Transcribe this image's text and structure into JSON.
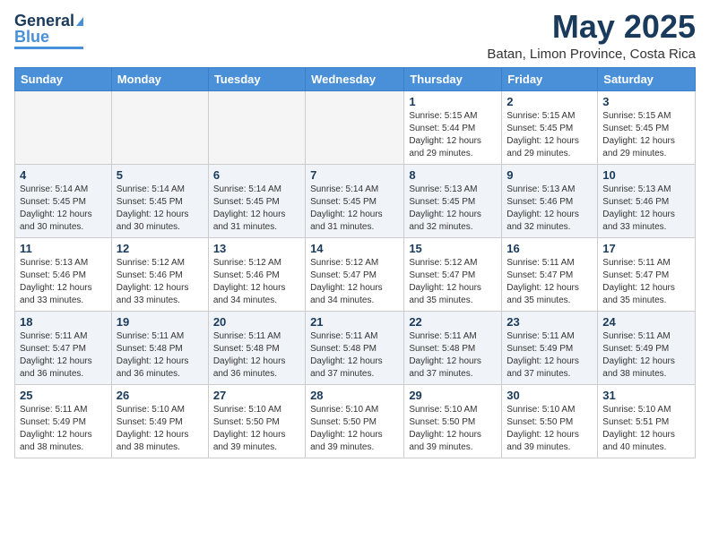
{
  "header": {
    "logo_line1": "General",
    "logo_line2": "Blue",
    "month": "May 2025",
    "location": "Batan, Limon Province, Costa Rica"
  },
  "days_of_week": [
    "Sunday",
    "Monday",
    "Tuesday",
    "Wednesday",
    "Thursday",
    "Friday",
    "Saturday"
  ],
  "weeks": [
    [
      {
        "day": "",
        "info": ""
      },
      {
        "day": "",
        "info": ""
      },
      {
        "day": "",
        "info": ""
      },
      {
        "day": "",
        "info": ""
      },
      {
        "day": "1",
        "info": "Sunrise: 5:15 AM\nSunset: 5:44 PM\nDaylight: 12 hours\nand 29 minutes."
      },
      {
        "day": "2",
        "info": "Sunrise: 5:15 AM\nSunset: 5:45 PM\nDaylight: 12 hours\nand 29 minutes."
      },
      {
        "day": "3",
        "info": "Sunrise: 5:15 AM\nSunset: 5:45 PM\nDaylight: 12 hours\nand 29 minutes."
      }
    ],
    [
      {
        "day": "4",
        "info": "Sunrise: 5:14 AM\nSunset: 5:45 PM\nDaylight: 12 hours\nand 30 minutes."
      },
      {
        "day": "5",
        "info": "Sunrise: 5:14 AM\nSunset: 5:45 PM\nDaylight: 12 hours\nand 30 minutes."
      },
      {
        "day": "6",
        "info": "Sunrise: 5:14 AM\nSunset: 5:45 PM\nDaylight: 12 hours\nand 31 minutes."
      },
      {
        "day": "7",
        "info": "Sunrise: 5:14 AM\nSunset: 5:45 PM\nDaylight: 12 hours\nand 31 minutes."
      },
      {
        "day": "8",
        "info": "Sunrise: 5:13 AM\nSunset: 5:45 PM\nDaylight: 12 hours\nand 32 minutes."
      },
      {
        "day": "9",
        "info": "Sunrise: 5:13 AM\nSunset: 5:46 PM\nDaylight: 12 hours\nand 32 minutes."
      },
      {
        "day": "10",
        "info": "Sunrise: 5:13 AM\nSunset: 5:46 PM\nDaylight: 12 hours\nand 33 minutes."
      }
    ],
    [
      {
        "day": "11",
        "info": "Sunrise: 5:13 AM\nSunset: 5:46 PM\nDaylight: 12 hours\nand 33 minutes."
      },
      {
        "day": "12",
        "info": "Sunrise: 5:12 AM\nSunset: 5:46 PM\nDaylight: 12 hours\nand 33 minutes."
      },
      {
        "day": "13",
        "info": "Sunrise: 5:12 AM\nSunset: 5:46 PM\nDaylight: 12 hours\nand 34 minutes."
      },
      {
        "day": "14",
        "info": "Sunrise: 5:12 AM\nSunset: 5:47 PM\nDaylight: 12 hours\nand 34 minutes."
      },
      {
        "day": "15",
        "info": "Sunrise: 5:12 AM\nSunset: 5:47 PM\nDaylight: 12 hours\nand 35 minutes."
      },
      {
        "day": "16",
        "info": "Sunrise: 5:11 AM\nSunset: 5:47 PM\nDaylight: 12 hours\nand 35 minutes."
      },
      {
        "day": "17",
        "info": "Sunrise: 5:11 AM\nSunset: 5:47 PM\nDaylight: 12 hours\nand 35 minutes."
      }
    ],
    [
      {
        "day": "18",
        "info": "Sunrise: 5:11 AM\nSunset: 5:47 PM\nDaylight: 12 hours\nand 36 minutes."
      },
      {
        "day": "19",
        "info": "Sunrise: 5:11 AM\nSunset: 5:48 PM\nDaylight: 12 hours\nand 36 minutes."
      },
      {
        "day": "20",
        "info": "Sunrise: 5:11 AM\nSunset: 5:48 PM\nDaylight: 12 hours\nand 36 minutes."
      },
      {
        "day": "21",
        "info": "Sunrise: 5:11 AM\nSunset: 5:48 PM\nDaylight: 12 hours\nand 37 minutes."
      },
      {
        "day": "22",
        "info": "Sunrise: 5:11 AM\nSunset: 5:48 PM\nDaylight: 12 hours\nand 37 minutes."
      },
      {
        "day": "23",
        "info": "Sunrise: 5:11 AM\nSunset: 5:49 PM\nDaylight: 12 hours\nand 37 minutes."
      },
      {
        "day": "24",
        "info": "Sunrise: 5:11 AM\nSunset: 5:49 PM\nDaylight: 12 hours\nand 38 minutes."
      }
    ],
    [
      {
        "day": "25",
        "info": "Sunrise: 5:11 AM\nSunset: 5:49 PM\nDaylight: 12 hours\nand 38 minutes."
      },
      {
        "day": "26",
        "info": "Sunrise: 5:10 AM\nSunset: 5:49 PM\nDaylight: 12 hours\nand 38 minutes."
      },
      {
        "day": "27",
        "info": "Sunrise: 5:10 AM\nSunset: 5:50 PM\nDaylight: 12 hours\nand 39 minutes."
      },
      {
        "day": "28",
        "info": "Sunrise: 5:10 AM\nSunset: 5:50 PM\nDaylight: 12 hours\nand 39 minutes."
      },
      {
        "day": "29",
        "info": "Sunrise: 5:10 AM\nSunset: 5:50 PM\nDaylight: 12 hours\nand 39 minutes."
      },
      {
        "day": "30",
        "info": "Sunrise: 5:10 AM\nSunset: 5:50 PM\nDaylight: 12 hours\nand 39 minutes."
      },
      {
        "day": "31",
        "info": "Sunrise: 5:10 AM\nSunset: 5:51 PM\nDaylight: 12 hours\nand 40 minutes."
      }
    ]
  ]
}
